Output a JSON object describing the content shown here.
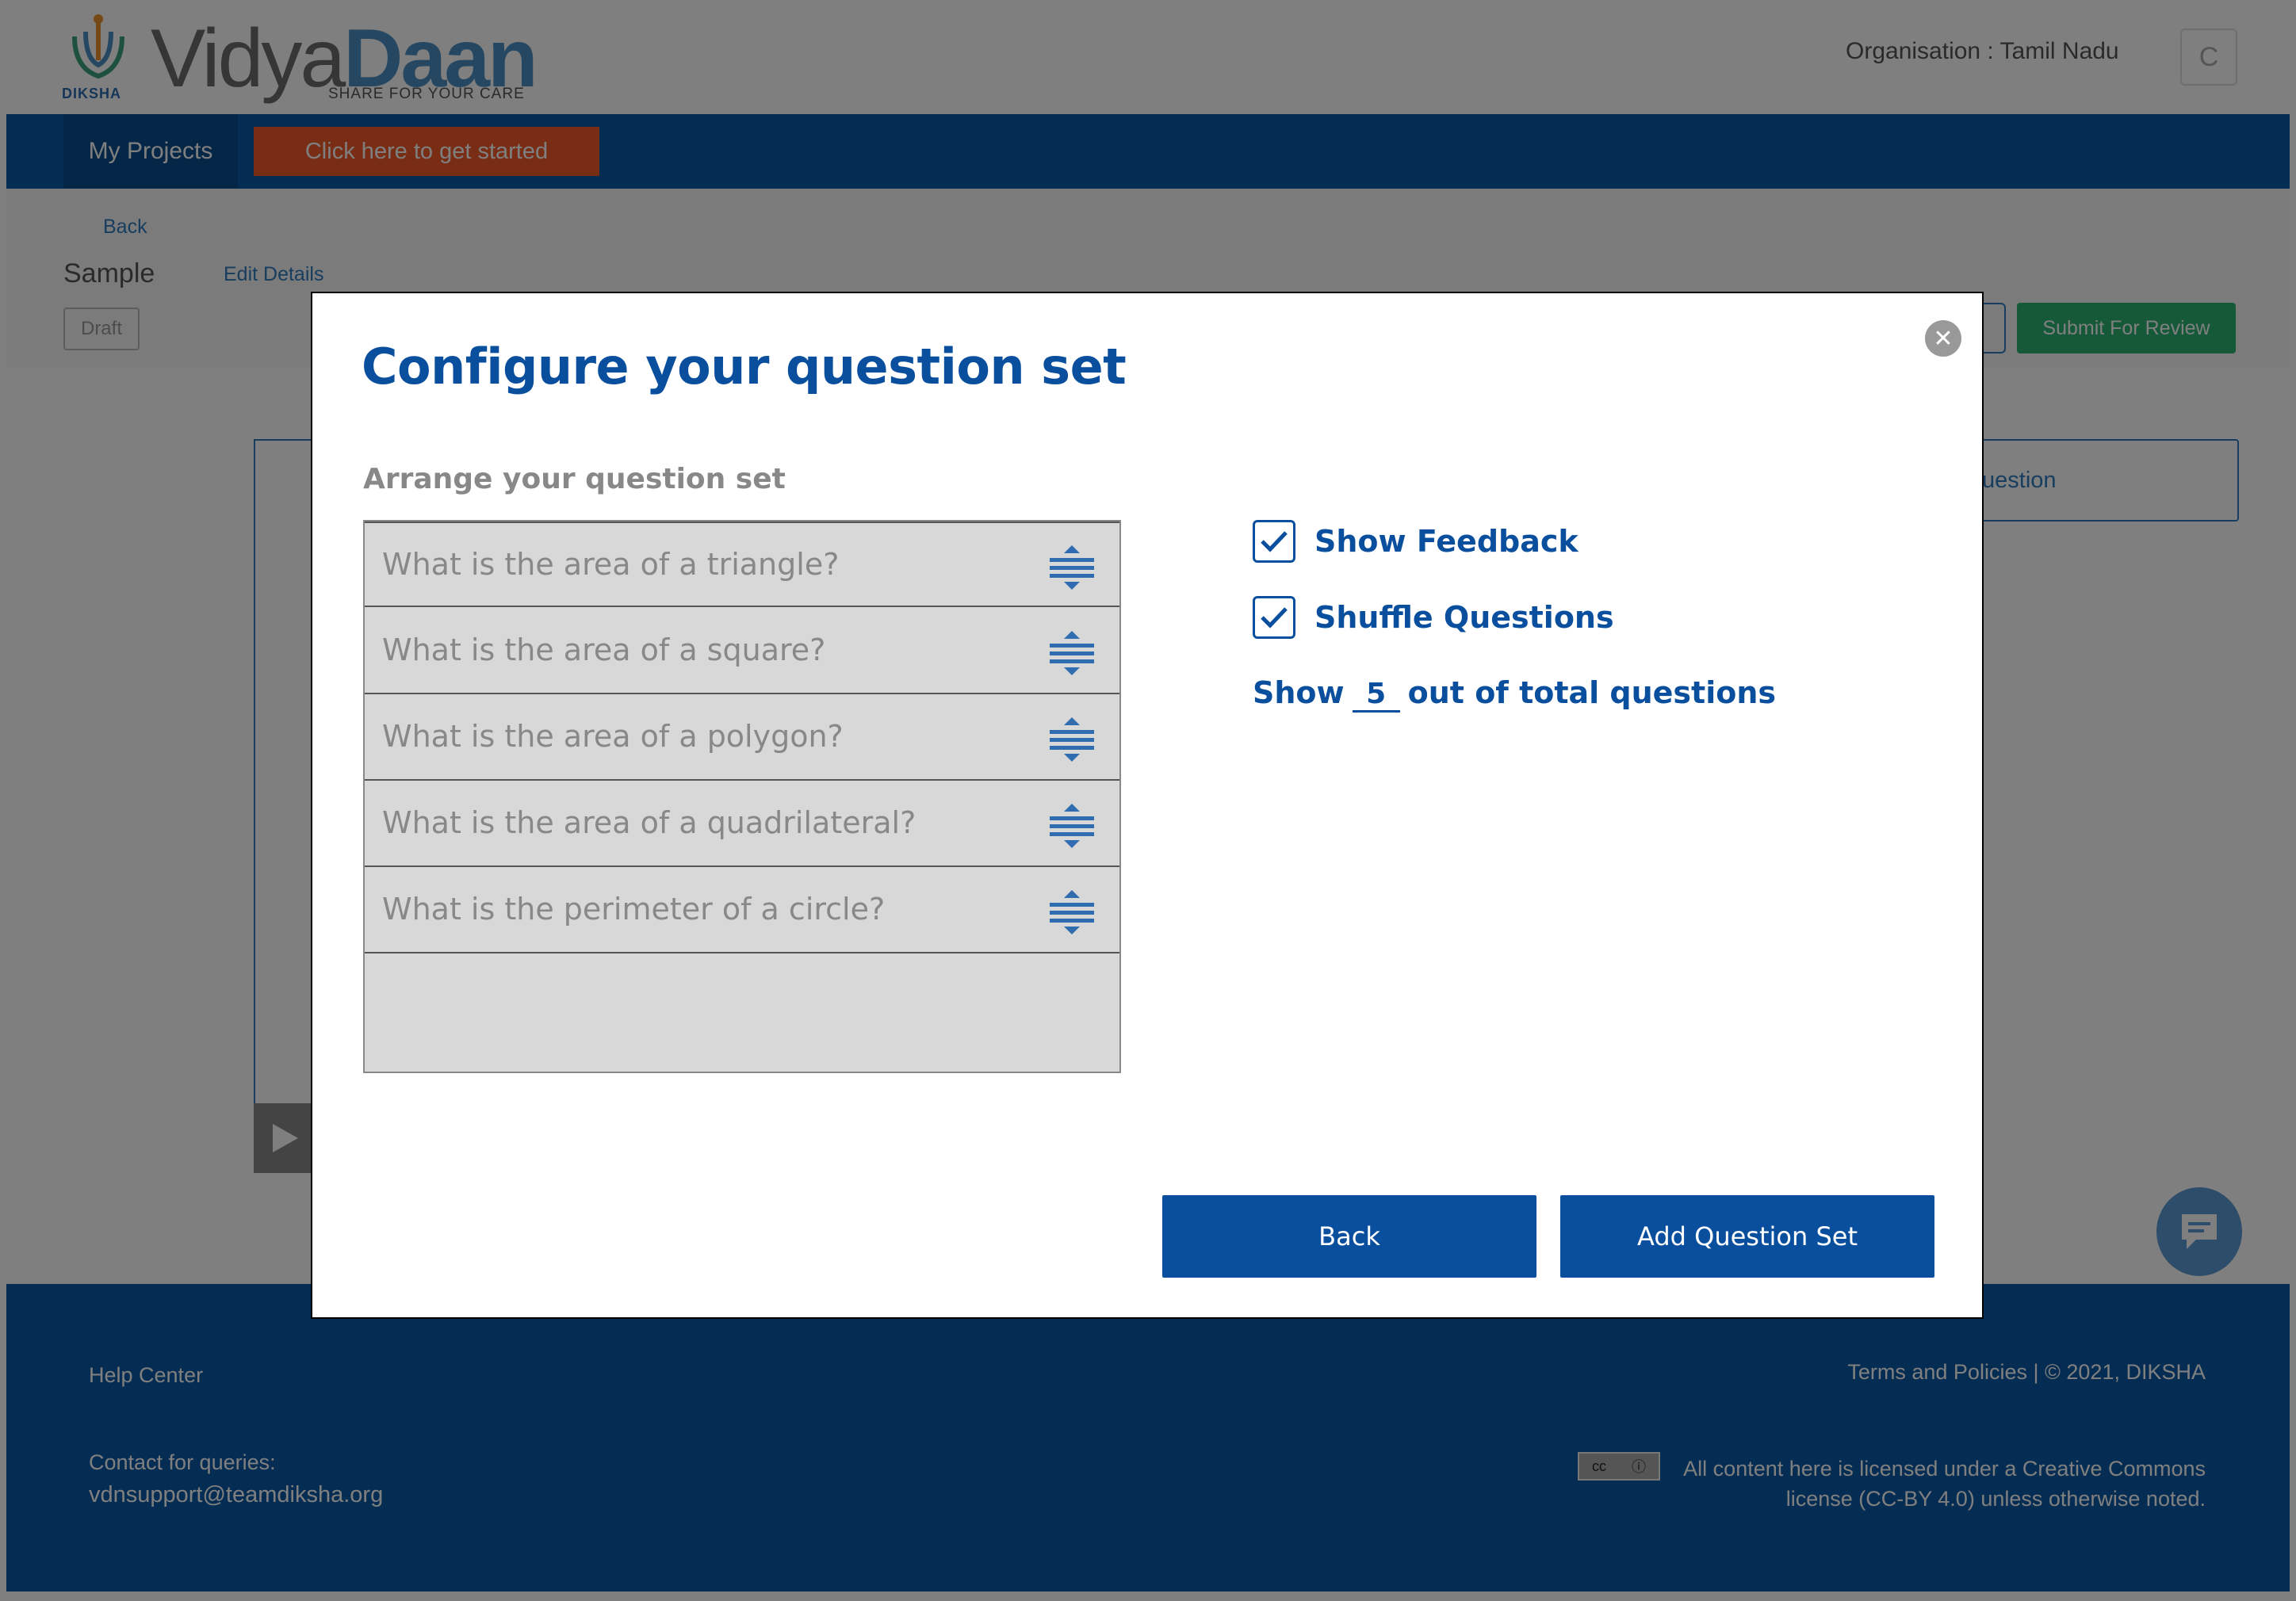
{
  "header": {
    "logo_word_1": "Vidya",
    "logo_word_2": "Daan",
    "logo_tagline": "SHARE FOR YOUR CARE",
    "logo_brand": "DIKSHA",
    "organisation": "Organisation : Tamil Nadu",
    "avatar_initial": "C"
  },
  "nav": {
    "my_projects": "My Projects",
    "get_started": "Click here to get started"
  },
  "subbar": {
    "back": "Back",
    "title": "Sample",
    "edit_details": "Edit Details",
    "status": "Draft",
    "submit_for_review": "Submit For Review"
  },
  "background": {
    "question_card_text": "uestion"
  },
  "modal": {
    "title": "Configure your question set",
    "arrange_label": "Arrange your question set",
    "questions": [
      "What is the area of a triangle?",
      "What is the area of a square?",
      "What is the area of a polygon?",
      "What is the area of a quadrilateral?",
      "What is the perimeter of a circle?"
    ],
    "show_feedback": {
      "label": "Show Feedback",
      "checked": true
    },
    "shuffle_questions": {
      "label": "Shuffle Questions",
      "checked": true
    },
    "show_prefix": "Show",
    "show_count": "5",
    "show_suffix": "out of total questions",
    "back_button": "Back",
    "add_button": "Add Question Set"
  },
  "footer": {
    "help_center": "Help Center",
    "contact_label": "Contact for queries:",
    "contact_email": "vdnsupport@teamdiksha.org",
    "terms": "Terms and Policies",
    "copyright": "| © 2021, DIKSHA",
    "license_line_1": "All content here is licensed under a Creative Commons",
    "license_line_2": "license (CC-BY 4.0) unless otherwise noted."
  },
  "colors": {
    "primary": "#0a4f9e",
    "nav": "#0b5aa6",
    "accent_orange": "#f05a28",
    "success": "#2cb273"
  }
}
